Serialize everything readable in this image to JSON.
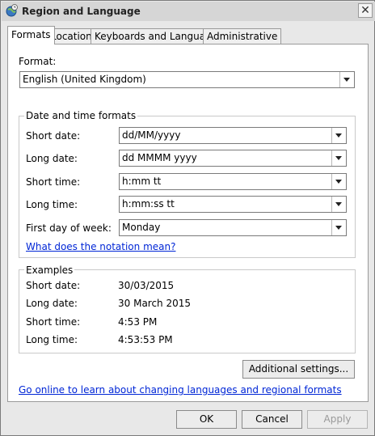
{
  "window": {
    "title": "Region and Language",
    "close_symbol": "✕"
  },
  "tabs": [
    {
      "label": "Formats",
      "active": true
    },
    {
      "label": "Location",
      "active": false
    },
    {
      "label": "Keyboards and Languages",
      "active": false
    },
    {
      "label": "Administrative",
      "active": false
    }
  ],
  "format": {
    "label": "Format:",
    "value": "English (United Kingdom)"
  },
  "date_time_formats": {
    "title": "Date and time formats",
    "short_date": {
      "label": "Short date:",
      "value": "dd/MM/yyyy"
    },
    "long_date": {
      "label": "Long date:",
      "value": "dd MMMM yyyy"
    },
    "short_time": {
      "label": "Short time:",
      "value": "h:mm tt"
    },
    "long_time": {
      "label": "Long time:",
      "value": "h:mm:ss tt"
    },
    "first_day": {
      "label": "First day of week:",
      "value": "Monday"
    },
    "notation_link": "What does the notation mean?"
  },
  "examples": {
    "title": "Examples",
    "short_date": {
      "label": "Short date:",
      "value": "30/03/2015"
    },
    "long_date": {
      "label": "Long date:",
      "value": "30 March 2015"
    },
    "short_time": {
      "label": "Short time:",
      "value": "4:53 PM"
    },
    "long_time": {
      "label": "Long time:",
      "value": "4:53:53 PM"
    }
  },
  "additional_settings_label": "Additional settings...",
  "online_link": "Go online to learn about changing languages and regional formats",
  "footer": {
    "ok": "OK",
    "cancel": "Cancel",
    "apply": "Apply"
  },
  "icons": {
    "app": "globe-clock-icon",
    "close": "close-icon",
    "dropdown": "chevron-down-icon"
  }
}
